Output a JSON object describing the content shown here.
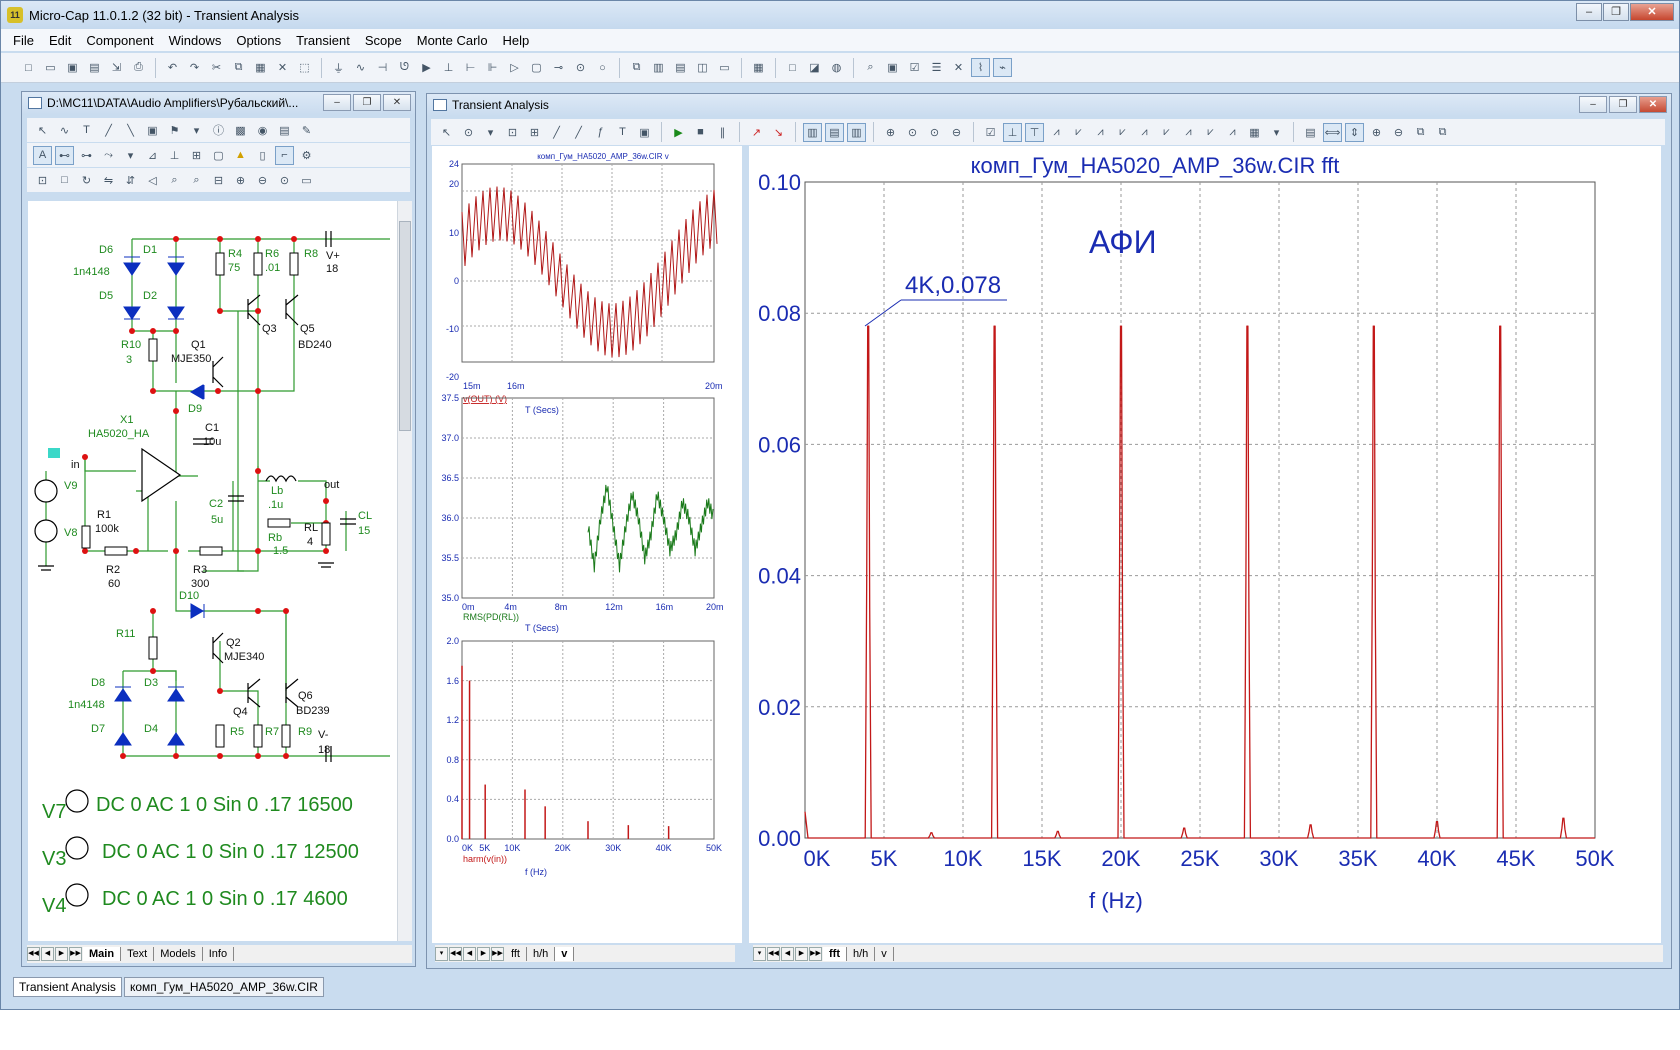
{
  "window": {
    "title": "Micro-Cap 11.0.1.2 (32 bit) - Transient Analysis",
    "app_icon": "11"
  },
  "menu": [
    "File",
    "Edit",
    "Component",
    "Windows",
    "Options",
    "Transient",
    "Scope",
    "Monte Carlo",
    "Help"
  ],
  "schematic_window": {
    "title": "D:\\MC11\\DATA\\Audio Amplifiers\\Рубальский\\...",
    "tabs": [
      "Main",
      "Text",
      "Models",
      "Info"
    ],
    "sources": [
      {
        "name": "V7",
        "value": "DC 0 AC 1 0 Sin 0 .17 16500"
      },
      {
        "name": "V3",
        "value": "DC 0 AC 1 0 Sin 0 .17 12500"
      },
      {
        "name": "V4",
        "value": "DC 0 AC 1 0 Sin 0 .17 4600"
      }
    ],
    "labels": {
      "D6": "D6",
      "D1": "D1",
      "n4148a": "1n4148",
      "D5": "D5",
      "D2": "D2",
      "R4": "R4",
      "R4v": "75",
      "R6": "R6",
      "R6v": ".01",
      "R8": "R8",
      "Vp": "V+",
      "Vpv": "18",
      "R10": "R10",
      "R10v": "3",
      "Q1": "Q1",
      "Q1m": "MJE350",
      "Q3": "Q3",
      "Q5": "Q5",
      "Q5m": "BD240",
      "D9": "D9",
      "X1": "X1",
      "X1m": "HA5020_HA",
      "C1": "C1",
      "C1v": "10u",
      "in": "in",
      "V9": "V9",
      "R1": "R1",
      "R1v": "100k",
      "V8": "V8",
      "C2": "C2",
      "C2v": "5u",
      "Lb": "Lb",
      "Lbv": ".1u",
      "out": "out",
      "Rb": "Rb",
      "Rbv": "1.5",
      "RL": "RL",
      "RLv": "4",
      "CL": "CL",
      "CLv": "15",
      "R2": "R2",
      "R2v": "60",
      "R3": "R3",
      "R3v": "300",
      "D10": "D10",
      "R11": "R11",
      "Q2": "Q2",
      "Q2m": "MJE340",
      "D8": "D8",
      "D3": "D3",
      "n4148b": "1n4148",
      "Q4": "Q4",
      "Q6": "Q6",
      "Q6m": "BD239",
      "D7": "D7",
      "D4": "D4",
      "R5": "R5",
      "R7": "R7",
      "R9": "R9",
      "Vm": "V-",
      "Vmv": "18"
    }
  },
  "analysis_window": {
    "title": "Transient Analysis",
    "left_tabs": [
      "fft",
      "h/h",
      "v"
    ],
    "right_tabs": [
      "fft",
      "h/h",
      "v"
    ]
  },
  "bottom_tabs": [
    "Transient Analysis",
    "комп_Гум_HA5020_AMP_36w.CIR"
  ],
  "chart_data": [
    {
      "type": "line",
      "title": "комп_Гум_HA5020_AMP_36w.CIR v",
      "xlabel": "T (Secs)",
      "ylabel_expr": "v(OUT) (V)",
      "x_ticks": [
        "15m",
        "16m",
        "20m"
      ],
      "y_ticks": [
        "24",
        "20",
        "10",
        "0",
        "-10",
        "-20"
      ],
      "ylim": [
        -20,
        24
      ],
      "series": [
        {
          "values_desc": "",
          "color": "#b01818"
        }
      ],
      "envelope": {
        "amplitude_pos": 17,
        "amplitude_neg": -17,
        "carrier_periods_visible": 1.1
      }
    },
    {
      "type": "line",
      "xlabel": "T (Secs)",
      "ylabel_expr": "RMS(PD(RL))",
      "x_ticks": [
        "0m",
        "4m",
        "8m",
        "12m",
        "16m",
        "20m"
      ],
      "y_ticks": [
        "37.5",
        "37.0",
        "36.5",
        "36.0",
        "35.5",
        "35.0"
      ],
      "xlim": [
        0,
        20
      ],
      "ylim": [
        35.0,
        37.5
      ],
      "color": "#1a7a1a",
      "x": [
        10.0,
        10.5,
        11.0,
        11.5,
        12.0,
        12.5,
        13.0,
        13.5,
        14.0,
        14.5,
        15.0,
        15.5,
        16.0,
        16.5,
        17.0,
        17.5,
        18.0,
        18.5,
        19.0,
        19.5,
        20.0
      ],
      "y": [
        35.9,
        35.4,
        36.0,
        36.4,
        35.9,
        35.4,
        35.9,
        36.3,
        36.0,
        35.5,
        35.8,
        36.3,
        36.0,
        35.6,
        35.8,
        36.2,
        36.0,
        35.6,
        35.9,
        36.2,
        36.0
      ]
    },
    {
      "type": "bar",
      "xlabel": "f (Hz)",
      "ylabel_expr": "harm(v(in))",
      "x_ticks": [
        "0K",
        "5K",
        "10K",
        "20K",
        "30K",
        "40K",
        "50K"
      ],
      "y_ticks": [
        "2.0",
        "1.6",
        "1.2",
        "0.8",
        "0.4",
        "0.0"
      ],
      "xlim": [
        0,
        50
      ],
      "ylim": [
        0,
        2.0
      ],
      "x": [
        0,
        1.5,
        4.6,
        12.5,
        16.5,
        25,
        33,
        41
      ],
      "y": [
        1.75,
        1.6,
        0.55,
        0.5,
        0.33,
        0.18,
        0.14,
        0.13
      ]
    },
    {
      "type": "line",
      "title": "комп_Гум_HA5020_AMP_36w.CIR fft",
      "xlabel": "f (Hz)",
      "annotation_title": "АФИ",
      "annotation": "4K,0.078",
      "x_ticks": [
        "0K",
        "5K",
        "10K",
        "15K",
        "20K",
        "25K",
        "30K",
        "35K",
        "40K",
        "45K",
        "50K"
      ],
      "y_ticks": [
        "0.10",
        "0.08",
        "0.06",
        "0.04",
        "0.02",
        "0.00"
      ],
      "xlim": [
        0,
        50000
      ],
      "ylim": [
        0,
        0.1
      ],
      "color": "#c21818",
      "x": [
        0,
        4000,
        8000,
        12000,
        16000,
        20000,
        24000,
        28000,
        32000,
        36000,
        40000,
        44000,
        48000
      ],
      "y": [
        0.004,
        0.078,
        0.0008,
        0.078,
        0.001,
        0.078,
        0.0015,
        0.078,
        0.002,
        0.078,
        0.0025,
        0.078,
        0.003
      ]
    }
  ]
}
